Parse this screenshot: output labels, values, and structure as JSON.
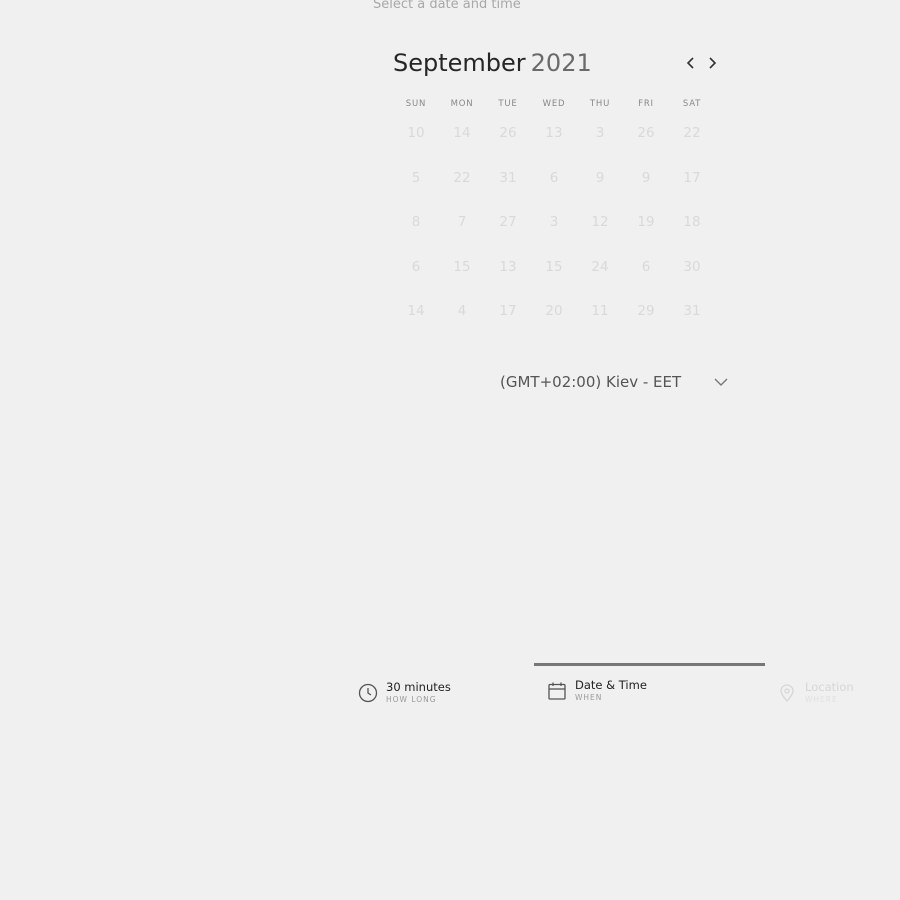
{
  "header": {
    "subtitle": "Select a date and time"
  },
  "calendar": {
    "month": "September",
    "year": "2021",
    "weekdays": [
      "SUN",
      "MON",
      "TUE",
      "WED",
      "THU",
      "FRI",
      "SAT"
    ],
    "days": [
      [
        "10",
        "14",
        "26",
        "13",
        "3",
        "26",
        "22"
      ],
      [
        "5",
        "22",
        "31",
        "6",
        "9",
        "9",
        "17"
      ],
      [
        "8",
        "7",
        "27",
        "3",
        "12",
        "19",
        "18"
      ],
      [
        "6",
        "15",
        "13",
        "15",
        "24",
        "6",
        "30"
      ],
      [
        "14",
        "4",
        "17",
        "20",
        "11",
        "29",
        "31"
      ]
    ]
  },
  "timezone": {
    "label": "(GMT+02:00) Kiev - EET"
  },
  "steps": {
    "duration": {
      "label": "30 minutes",
      "sub": "HOW LONG"
    },
    "datetime": {
      "label": "Date & Time",
      "sub": "WHEN"
    },
    "location": {
      "label": "Location",
      "sub": "WHERE"
    }
  },
  "icons": {
    "prev": "chevron-left-icon",
    "next": "chevron-right-icon",
    "timezone_toggle": "chevron-down-icon",
    "duration": "clock-icon",
    "datetime": "calendar-icon",
    "location": "map-pin-icon"
  },
  "colors": {
    "background": "#f0f0f0",
    "progress": "#777777",
    "disabled_day": "#d9d9d9"
  }
}
